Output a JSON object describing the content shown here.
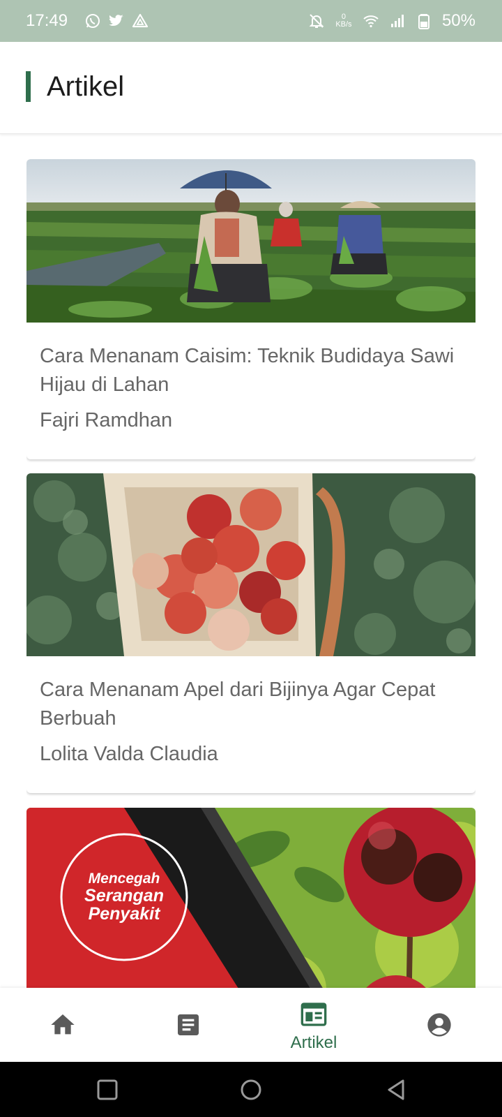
{
  "status_bar": {
    "time": "17:49",
    "kbps_value": "0",
    "kbps_unit": "KB/s",
    "battery": "50%",
    "left_icons": [
      "whatsapp-icon",
      "twitter-icon",
      "drive-icon"
    ],
    "right_icons": [
      "mute-icon",
      "wifi-icon",
      "signal-icon",
      "battery-icon"
    ]
  },
  "header": {
    "title": "Artikel"
  },
  "articles": [
    {
      "title": "Cara Menanam Caisim: Teknik Budidaya Sawi Hijau di Lahan",
      "author": "Fajri Ramdhan"
    },
    {
      "title": "Cara Menanam Apel dari Bijinya Agar Cepat Berbuah",
      "author": "Lolita Valda Claudia"
    },
    {
      "image_text": [
        "Mencegah",
        "Serangan",
        "Penyakit"
      ]
    }
  ],
  "bottom_nav": {
    "active_label": "Artikel",
    "items": [
      "home-icon",
      "list-icon",
      "article-icon",
      "profile-icon"
    ]
  },
  "colors": {
    "status_bar": "#aec4b3",
    "accent": "#2f6e4c",
    "text": "#666666"
  }
}
